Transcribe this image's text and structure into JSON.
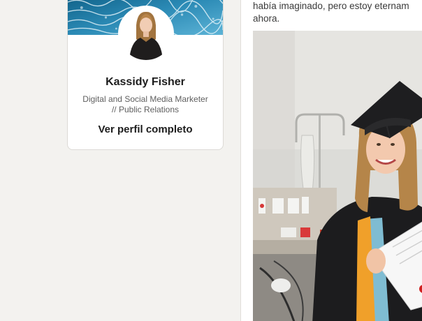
{
  "profile": {
    "name": "Kassidy Fisher",
    "headline_line1": "Digital and Social Media Marketer",
    "headline_line2": "// Public Relations",
    "view_profile_label": "Ver perfil completo",
    "avatar_icon": "profile-photo",
    "cover_icon": "ocean-waves-cover"
  },
  "feed": {
    "post": {
      "text_line1": "había imaginado, pero estoy eternam",
      "text_line2": "ahora.",
      "image_icon": "graduation-photo-hospital"
    }
  },
  "colors": {
    "page_bg": "#f3f2ef",
    "card_bg": "#ffffff",
    "ocean": "#2b7fa8"
  }
}
